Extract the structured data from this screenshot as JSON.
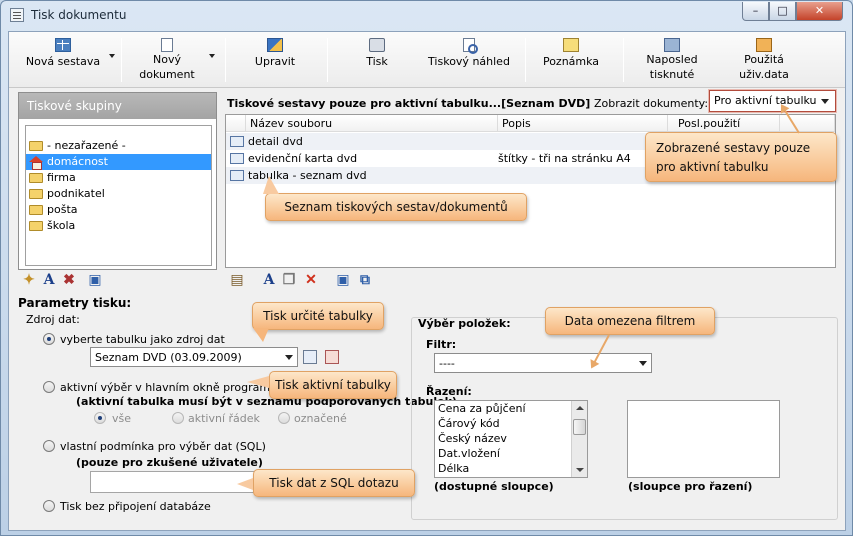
{
  "window": {
    "title": "Tisk dokumentu",
    "min": "–",
    "max": "□",
    "close": "✕"
  },
  "toolbar": {
    "new_report": "Nová sestava",
    "new_doc_1": "Nový",
    "new_doc_2": "dokument",
    "edit": "Upravit",
    "print": "Tisk",
    "preview": "Tiskový náhled",
    "note": "Poznámka",
    "last_1": "Naposled",
    "last_2": "tisknuté",
    "used_1": "Použitá",
    "used_2": "uživ.data"
  },
  "groups": {
    "header": "Tiskové skupiny",
    "items": [
      "- nezařazené -",
      "domácnost",
      "firma",
      "podnikatel",
      "pošta",
      "škola"
    ],
    "selected_index": 1
  },
  "reports": {
    "title": "Tiskové sestavy pouze pro aktivní tabulku...[Seznam DVD]",
    "show_label": "Zobrazit dokumenty:",
    "show_value": "Pro aktivní tabulku",
    "columns": [
      "Název souboru",
      "Popis",
      "Posl.použití"
    ],
    "rows": [
      {
        "name": "detail dvd",
        "desc": ""
      },
      {
        "name": "evidenční karta dvd",
        "desc": "štítky - tři na stránku A4"
      },
      {
        "name": "tabulka - seznam dvd",
        "desc": ""
      }
    ]
  },
  "params": {
    "title": "Parametry tisku:",
    "source_label": "Zdroj dat:",
    "opt1": "vyberte tabulku jako zdroj dat",
    "opt1_value": "Seznam DVD (03.09.2009)",
    "opt2": "aktivní výběr v hlavním okně programu",
    "opt2_note": "(aktivní tabulka musí být v seznamu podporovaných tabulek)",
    "sub_all": "vše",
    "sub_row": "aktivní řádek",
    "sub_marked": "označené",
    "opt3": "vlastní podmínka pro výběr dat (SQL)",
    "opt3_note": "(pouze pro zkušené uživatele)",
    "opt4": "Tisk bez připojení databáze"
  },
  "selection": {
    "title": "Výběr položek:",
    "filter_label": "Filtr:",
    "filter_value": "----",
    "sort_label": "Řazení:",
    "available": [
      "Cena za půjčení",
      "Čárový kód",
      "Český název",
      "Dat.vložení",
      "Délka"
    ],
    "available_caption": "(dostupné sloupce)",
    "sort_caption": "(sloupce pro řazení)"
  },
  "callouts": {
    "c_show": "Zobrazené sestavy pouze pro aktivní tabulku",
    "c_list": "Seznam tiskových sestav/dokumentů",
    "c_table": "Tisk určité tabulky",
    "c_active": "Tisk aktivní tabulky",
    "c_sql": "Tisk dat z SQL dotazu",
    "c_filter": "Data omezena filtrem"
  },
  "colors": {
    "selection": "#3399ff",
    "callout": "#f6b67c",
    "header_gray": "#a8a8a8"
  }
}
